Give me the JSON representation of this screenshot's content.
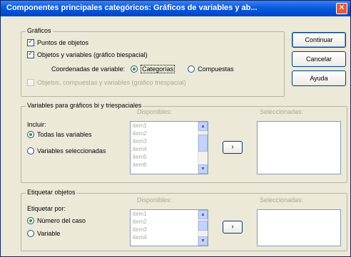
{
  "window": {
    "title": "Componentes principales categóricos: Gráficos de variables y ab...",
    "close_glyph": "✕"
  },
  "graficos": {
    "title": "Gráficos",
    "puntos_objetos": "Puntos de objetos",
    "objetos_variables": "Objetos y variables (gráfico biespacial)",
    "coord_label": "Coordenadas de variable:",
    "categorias": "Categorías",
    "compuestas": "Compuestas",
    "triespacial": "Objetos, compuestas y variables (gráfico triespacial)"
  },
  "buttons": {
    "continuar": "Continuar",
    "cancelar": "Cancelar",
    "ayuda": "Ayuda"
  },
  "variables_group": {
    "title": "Variables para gráficos bi y triespaciales",
    "incluir": "Incluir:",
    "todas": "Todas las variables",
    "seleccionadas_opt": "Variables seleccionadas",
    "disponibles_label": "Disponibles:",
    "seleccionadas_label": "Seleccionadas:",
    "items": [
      "item1",
      "item2",
      "item3",
      "item4",
      "item5",
      "item6"
    ],
    "arrow": "›"
  },
  "etiquetar_group": {
    "title": "Etiquetar objetos",
    "etiquetar_por": "Etiquetar por:",
    "numero_caso": "Número del caso",
    "variable": "Variable",
    "disponibles_label": "Disponibles:",
    "seleccionadas_label": "Seleccionadas:",
    "items": [
      "item1",
      "item2",
      "item3",
      "item4"
    ],
    "arrow": "›"
  }
}
